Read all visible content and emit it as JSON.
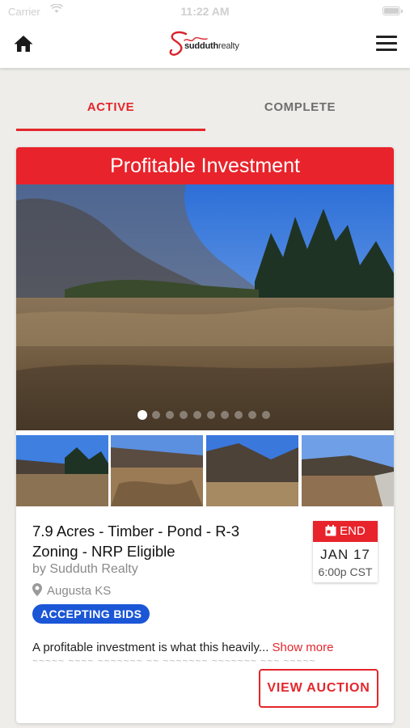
{
  "status_bar": {
    "carrier": "Carrier",
    "time": "11:22 AM"
  },
  "header": {
    "logo_script": "S",
    "logo_brand": "sudduth",
    "logo_suffix": "realty"
  },
  "tabs": [
    {
      "label": "ACTIVE",
      "active": true
    },
    {
      "label": "COMPLETE",
      "active": false
    }
  ],
  "listing": {
    "banner": "Profitable Investment",
    "carousel": {
      "total_slides": 10,
      "current_slide": 1
    },
    "title": "7.9 Acres - Timber - Pond - R-3 Zoning - NRP Eligible",
    "by": "by Sudduth Realty",
    "location": "Augusta KS",
    "status_badge": "ACCEPTING BIDS",
    "end_label": "END",
    "end_date": "JAN 17",
    "end_time": "6:00p CST",
    "description": "A profitable investment is what this heavily...",
    "show_more": "Show more",
    "cta": "VIEW AUCTION"
  },
  "colors": {
    "accent": "#e8232b",
    "badge": "#1a56d6",
    "tab_inactive": "#6e6e6e"
  },
  "icons": [
    "home-icon",
    "hamburger-menu-icon",
    "map-pin-icon",
    "calendar-icon",
    "wifi-icon",
    "battery-icon"
  ]
}
